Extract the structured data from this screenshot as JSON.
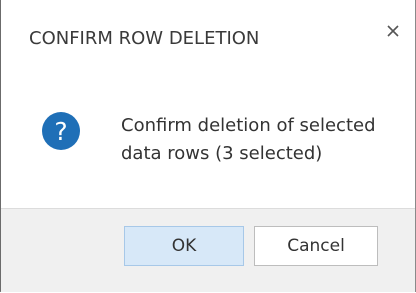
{
  "dialog": {
    "title": "CONFIRM ROW DELETION",
    "close_icon": "close-icon",
    "icon": "question-icon",
    "message_line1": "Confirm deletion of selected",
    "message_line2": "data rows (3 selected)",
    "buttons": {
      "ok": "OK",
      "cancel": "Cancel"
    }
  },
  "colors": {
    "question_icon": "#1f6fb7",
    "ok_button_bg": "#d7e8f8",
    "footer_bg": "#f0f0f0"
  }
}
